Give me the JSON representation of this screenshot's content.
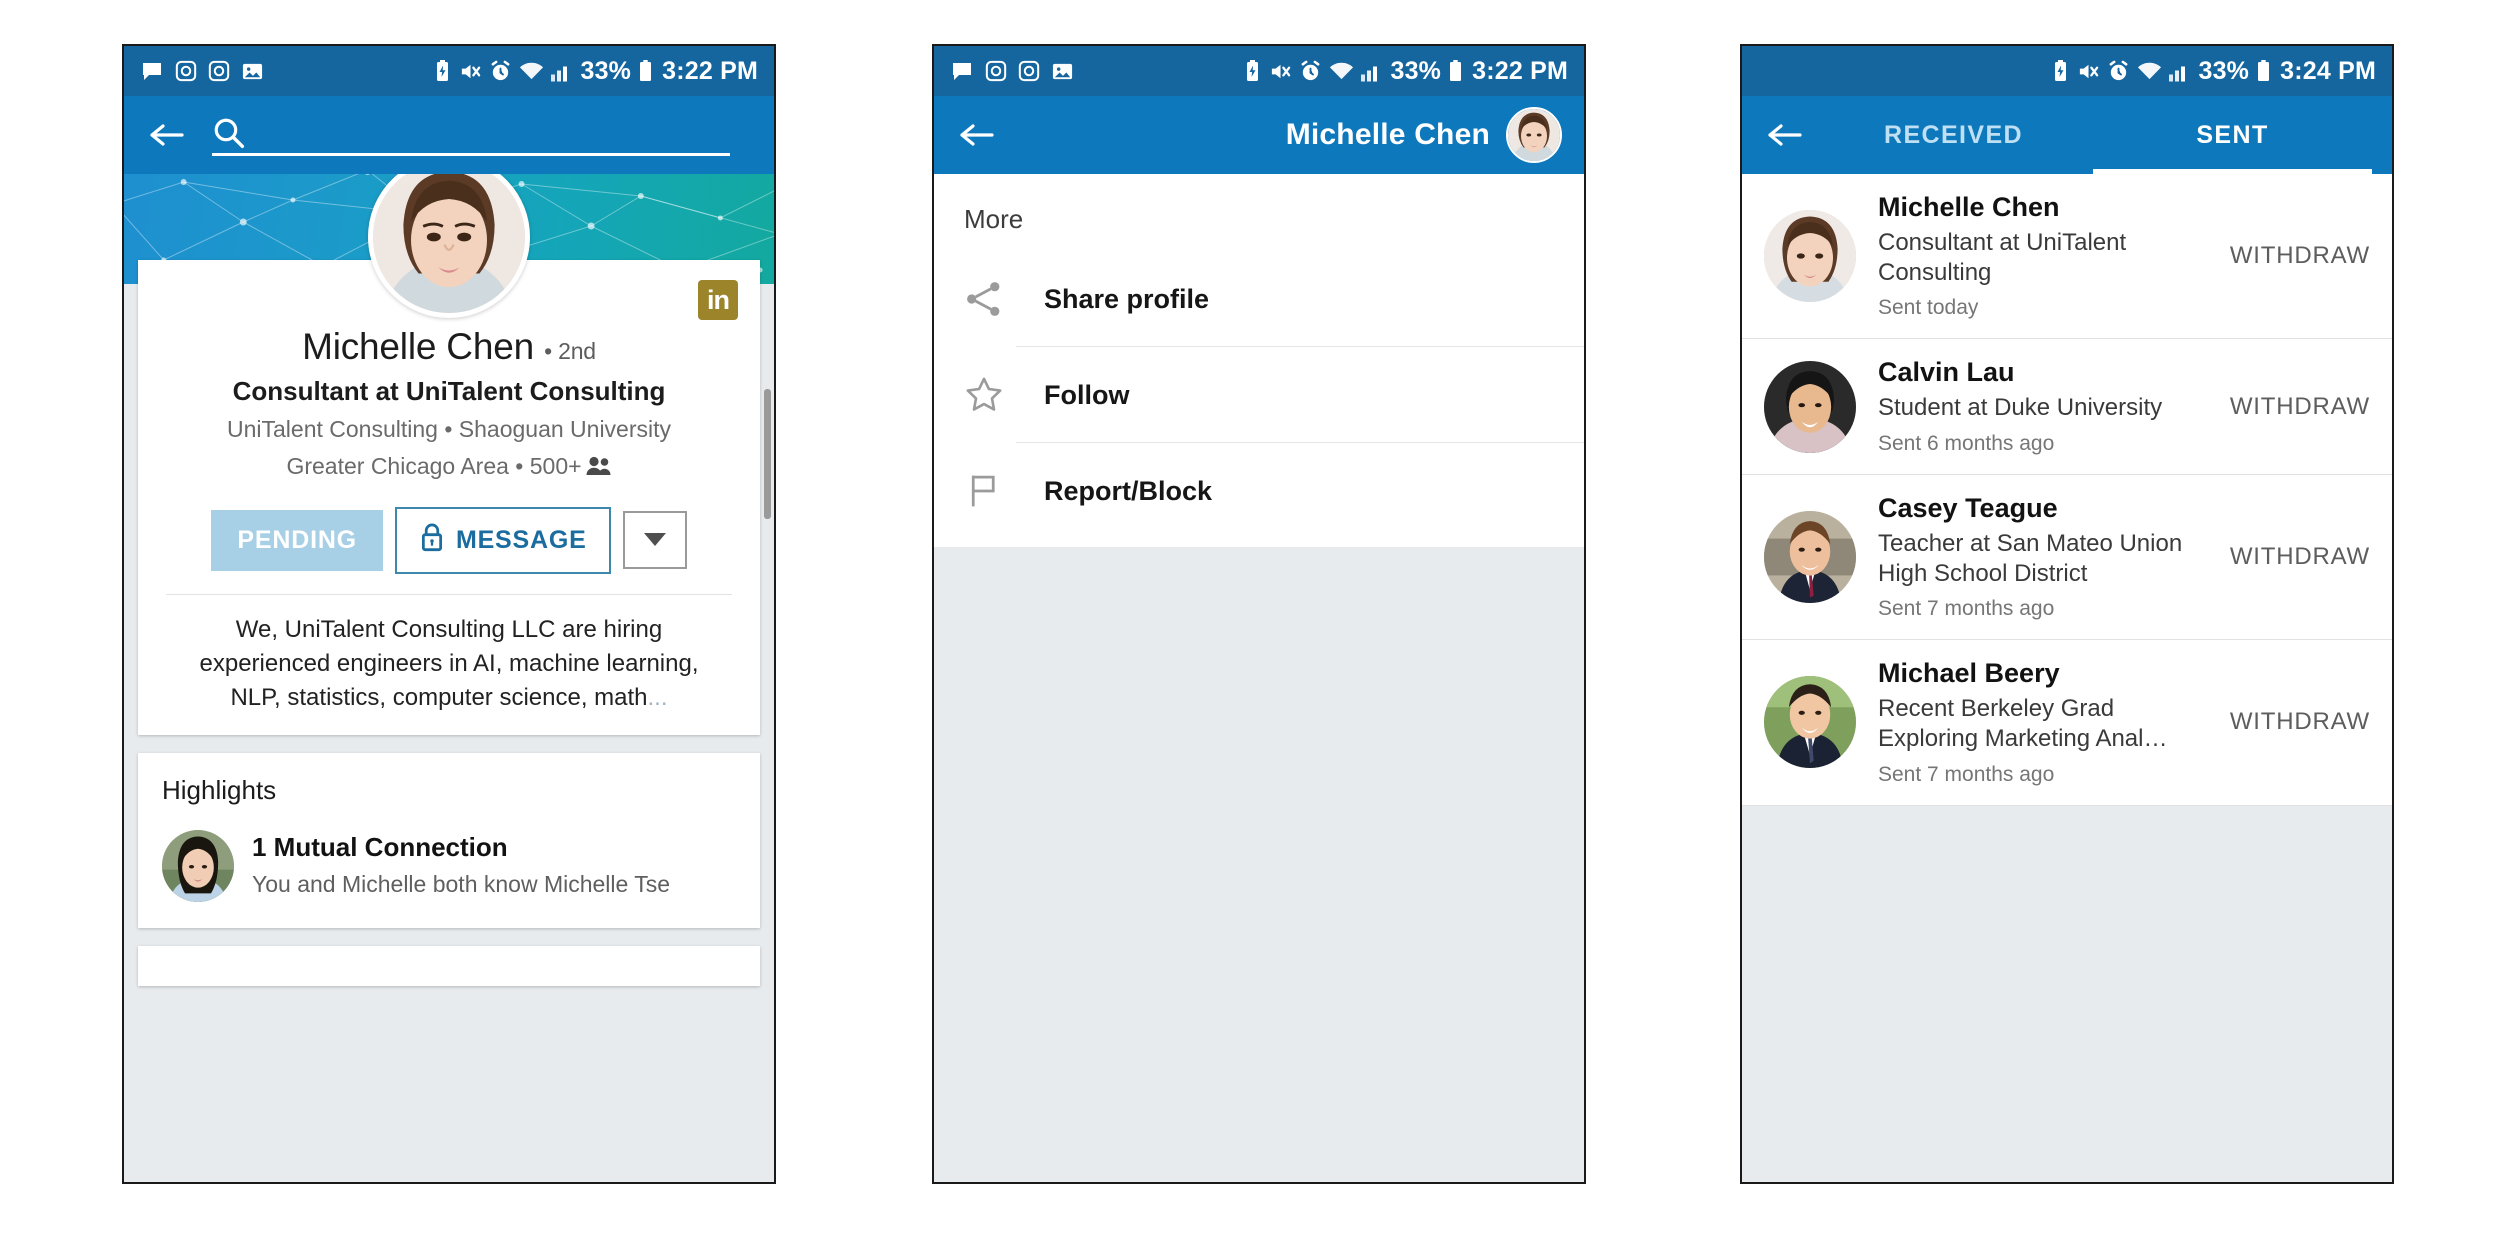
{
  "statusbar": {
    "left_icons": [
      "message-icon",
      "camera-icon",
      "camera-icon",
      "photo-icon"
    ],
    "right_icons": [
      "battery-saver-icon",
      "mute-icon",
      "alarm-icon",
      "wifi-icon",
      "signal-icon"
    ],
    "battery_percent": "33%",
    "time_2322": "3:22 PM",
    "time_2324": "3:24 PM"
  },
  "phone1": {
    "appbar": {
      "back": "back-arrow",
      "search_icon": "search-icon",
      "search_value": "",
      "search_placeholder": ""
    },
    "profile": {
      "name": "Michelle Chen",
      "degree": "• 2nd",
      "headline": "Consultant at UniTalent Consulting",
      "subline1": "UniTalent Consulting • Shaoguan University",
      "subline2": "Greater Chicago Area • 500+",
      "badge_text": "in",
      "buttons": {
        "pending": "PENDING",
        "message": "MESSAGE",
        "dropdown": "chevron-down-icon"
      },
      "summary": "We, UniTalent Consulting LLC are hiring experienced engineers in AI, machine learning, NLP, statistics, computer science, math",
      "summary_more": "..."
    },
    "highlights": {
      "title": "Highlights",
      "item_heading": "1 Mutual Connection",
      "item_sub": "You and Michelle both know Michelle Tse"
    }
  },
  "phone2": {
    "appbar": {
      "title": "Michelle Chen",
      "avatar": "avatar"
    },
    "menu": {
      "title": "More",
      "items": [
        {
          "label": "Share profile",
          "icon": "share-icon"
        },
        {
          "label": "Follow",
          "icon": "star-icon"
        },
        {
          "label": "Report/Block",
          "icon": "flag-icon"
        }
      ]
    }
  },
  "phone3": {
    "tabs": [
      {
        "label": "RECEIVED",
        "active": false
      },
      {
        "label": "SENT",
        "active": true
      }
    ],
    "invitations": [
      {
        "name": "Michelle Chen",
        "title": "Consultant at UniTalent Consulting",
        "sent": "Sent today",
        "action": "WITHDRAW"
      },
      {
        "name": "Calvin Lau",
        "title": "Student at Duke University",
        "sent": "Sent 6 months ago",
        "action": "WITHDRAW"
      },
      {
        "name": "Casey Teague",
        "title": "Teacher at San Mateo Union High School District",
        "sent": "Sent 7 months ago",
        "action": "WITHDRAW"
      },
      {
        "name": "Michael Beery",
        "title": "Recent Berkeley Grad Exploring Marketing Anal…",
        "sent": "Sent 7 months ago",
        "action": "WITHDRAW"
      }
    ]
  },
  "colors": {
    "statusbar": "#15659f",
    "appbar": "#0e78bd",
    "pending_button": "#a7cfe6",
    "message_text": "#1a6d9e",
    "badge_gold": "#9c842b",
    "page_bg": "#e8ebee"
  }
}
